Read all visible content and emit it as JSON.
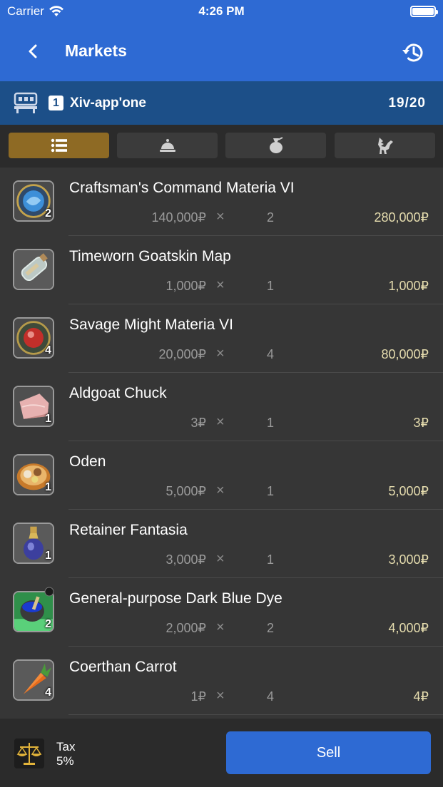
{
  "status_bar": {
    "carrier": "Carrier",
    "time": "4:26 PM"
  },
  "nav": {
    "title": "Markets"
  },
  "retainer": {
    "index": "1",
    "name": "Xiv-app'one",
    "slots": "19/20"
  },
  "tabs": [
    {
      "icon": "list-icon",
      "active": true
    },
    {
      "icon": "bell-icon",
      "active": false
    },
    {
      "icon": "bag-icon",
      "active": false
    },
    {
      "icon": "chocobo-icon",
      "active": false
    }
  ],
  "items": [
    {
      "name": "Craftsman's Command Materia VI",
      "qty": "2",
      "price": "140,000₽",
      "times": "×",
      "count": "2",
      "total": "280,000₽",
      "icon": "blue-materia-icon"
    },
    {
      "name": "Timeworn Goatskin Map",
      "qty": "",
      "price": "1,000₽",
      "times": "×",
      "count": "1",
      "total": "1,000₽",
      "icon": "bottle-map-icon"
    },
    {
      "name": "Savage Might Materia VI",
      "qty": "4",
      "price": "20,000₽",
      "times": "×",
      "count": "4",
      "total": "80,000₽",
      "icon": "red-materia-icon"
    },
    {
      "name": "Aldgoat Chuck",
      "qty": "1",
      "price": "3₽",
      "times": "×",
      "count": "1",
      "total": "3₽",
      "icon": "meat-icon"
    },
    {
      "name": "Oden",
      "qty": "1",
      "price": "5,000₽",
      "times": "×",
      "count": "1",
      "total": "5,000₽",
      "icon": "oden-bowl-icon"
    },
    {
      "name": "Retainer Fantasia",
      "qty": "1",
      "price": "3,000₽",
      "times": "×",
      "count": "1",
      "total": "3,000₽",
      "icon": "potion-icon"
    },
    {
      "name": "General-purpose Dark Blue Dye",
      "qty": "2",
      "price": "2,000₽",
      "times": "×",
      "count": "2",
      "total": "4,000₽",
      "icon": "dye-pot-icon"
    },
    {
      "name": "Coerthan Carrot",
      "qty": "4",
      "price": "1₽",
      "times": "×",
      "count": "4",
      "total": "4₽",
      "icon": "carrot-icon"
    }
  ],
  "footer": {
    "tax_label": "Tax",
    "tax_value": "5%",
    "sell_label": "Sell"
  },
  "colors": {
    "accent": "#2e6ad3",
    "retainer_bar": "#1c4f88",
    "active_tab": "#8e6a24",
    "total_text": "#e5dcae"
  }
}
